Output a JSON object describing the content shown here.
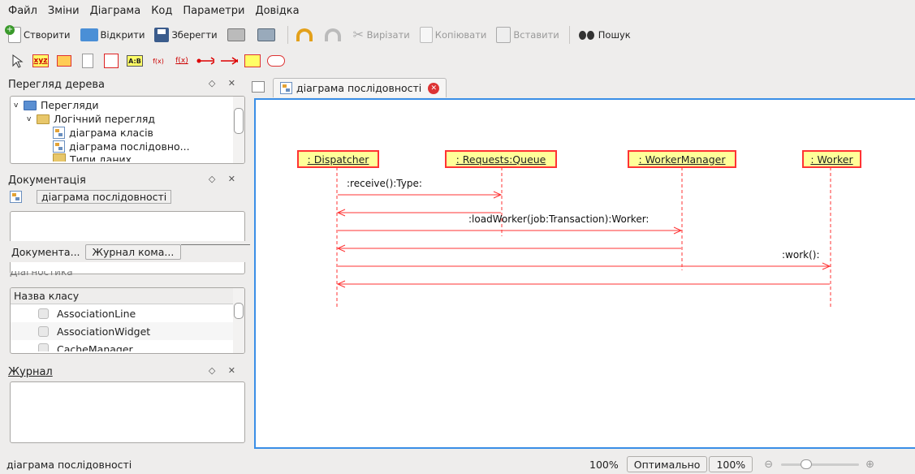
{
  "menu": [
    "Файл",
    "Зміни",
    "Діаграма",
    "Код",
    "Параметри",
    "Довідка"
  ],
  "toolbar": {
    "new": "Створити",
    "open": "Відкрити",
    "save": "Зберегти",
    "cut": "Вирізати",
    "copy": "Копіювати",
    "paste": "Вставити",
    "search": "Пошук"
  },
  "tree_panel": {
    "title": "Перегляд дерева",
    "items": [
      "Перегляди",
      "Логічний перегляд",
      "діаграма класів",
      "діаграма послідовно...",
      "Типи даних"
    ]
  },
  "doc_panel": {
    "title": "Документація",
    "diagram_name": "діаграма послідовності",
    "tab_doc": "Документа...",
    "tab_log": "Журнал кома...",
    "hidden_title": "Діагностика"
  },
  "class_panel": {
    "header": "Назва класу",
    "items": [
      "AssociationLine",
      "AssociationWidget",
      "CacheManager"
    ]
  },
  "journal_panel": {
    "title": "Журнал"
  },
  "diagram_tab": {
    "label": "діаграма послідовності"
  },
  "diagram": {
    "lifelines": [
      ": Dispatcher",
      ": Requests:Queue",
      ": WorkerManager",
      ": Worker"
    ],
    "messages": [
      ":receive():Type:",
      ":loadWorker(job:Transaction):Worker:",
      ":work():"
    ],
    "colors": {
      "box_fill": "#ffff99",
      "border": "#ff3333",
      "canvas_border": "#3a8ee6"
    }
  },
  "status": {
    "text": "діаграма послідовності",
    "zoom": "100%",
    "optimal": "Оптимально",
    "zoom2": "100%"
  }
}
